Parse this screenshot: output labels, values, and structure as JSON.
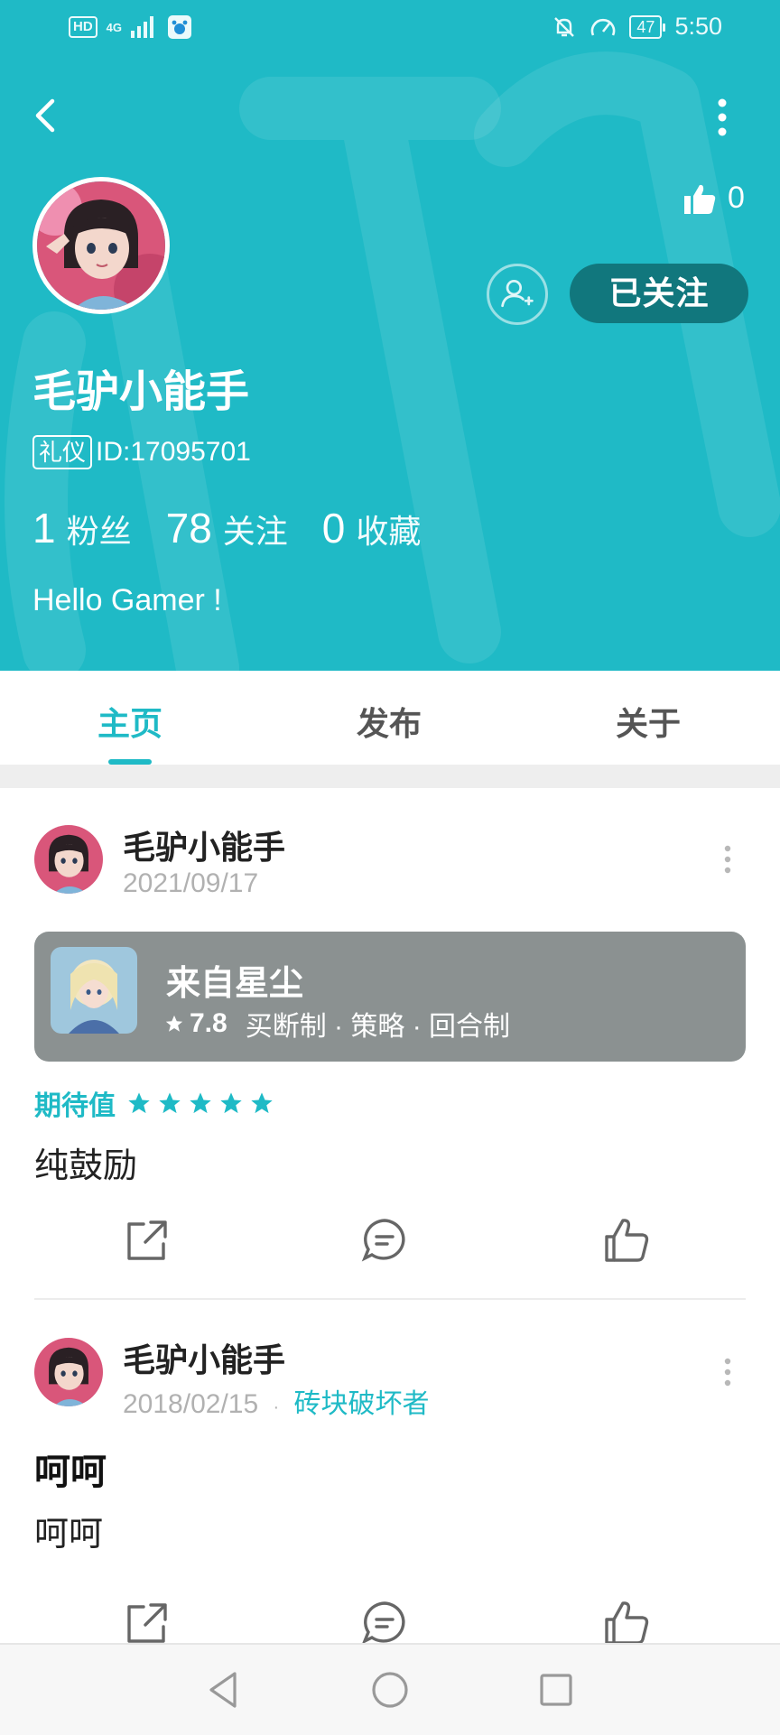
{
  "status_bar": {
    "hd": "HD",
    "network": "4G",
    "battery": "47",
    "time": "5:50"
  },
  "profile": {
    "likes": "0",
    "follow_label": "已关注",
    "username": "毛驴小能手",
    "badge": "礼仪",
    "id_text": "ID:17095701",
    "fans_count": "1",
    "fans_label": "粉丝",
    "following_count": "78",
    "following_label": "关注",
    "favorites_count": "0",
    "favorites_label": "收藏",
    "bio": "Hello Gamer !"
  },
  "tabs": [
    {
      "label": "主页",
      "active": true
    },
    {
      "label": "发布",
      "active": false
    },
    {
      "label": "关于",
      "active": false
    }
  ],
  "posts": [
    {
      "author": "毛驴小能手",
      "date": "2021/09/17",
      "game": {
        "title": "来自星尘",
        "rating": "7.8",
        "tags": "买断制 · 策略 · 回合制"
      },
      "expect_label": "期待值",
      "stars": 5,
      "text": "纯鼓励"
    },
    {
      "author": "毛驴小能手",
      "date": "2018/02/15",
      "separator": "·",
      "tag": "砖块破坏者",
      "title": "呵呵",
      "text": "呵呵"
    }
  ],
  "colors": {
    "accent": "#1fbac6",
    "follow_button": "#11777d",
    "game_card": "#8b9191"
  },
  "icons": [
    "back-arrow-icon",
    "more-vert-icon",
    "thumbs-up-icon",
    "add-friend-icon",
    "share-icon",
    "comment-icon",
    "like-icon",
    "star-icon",
    "nav-back-icon",
    "nav-home-icon",
    "nav-recent-icon"
  ]
}
